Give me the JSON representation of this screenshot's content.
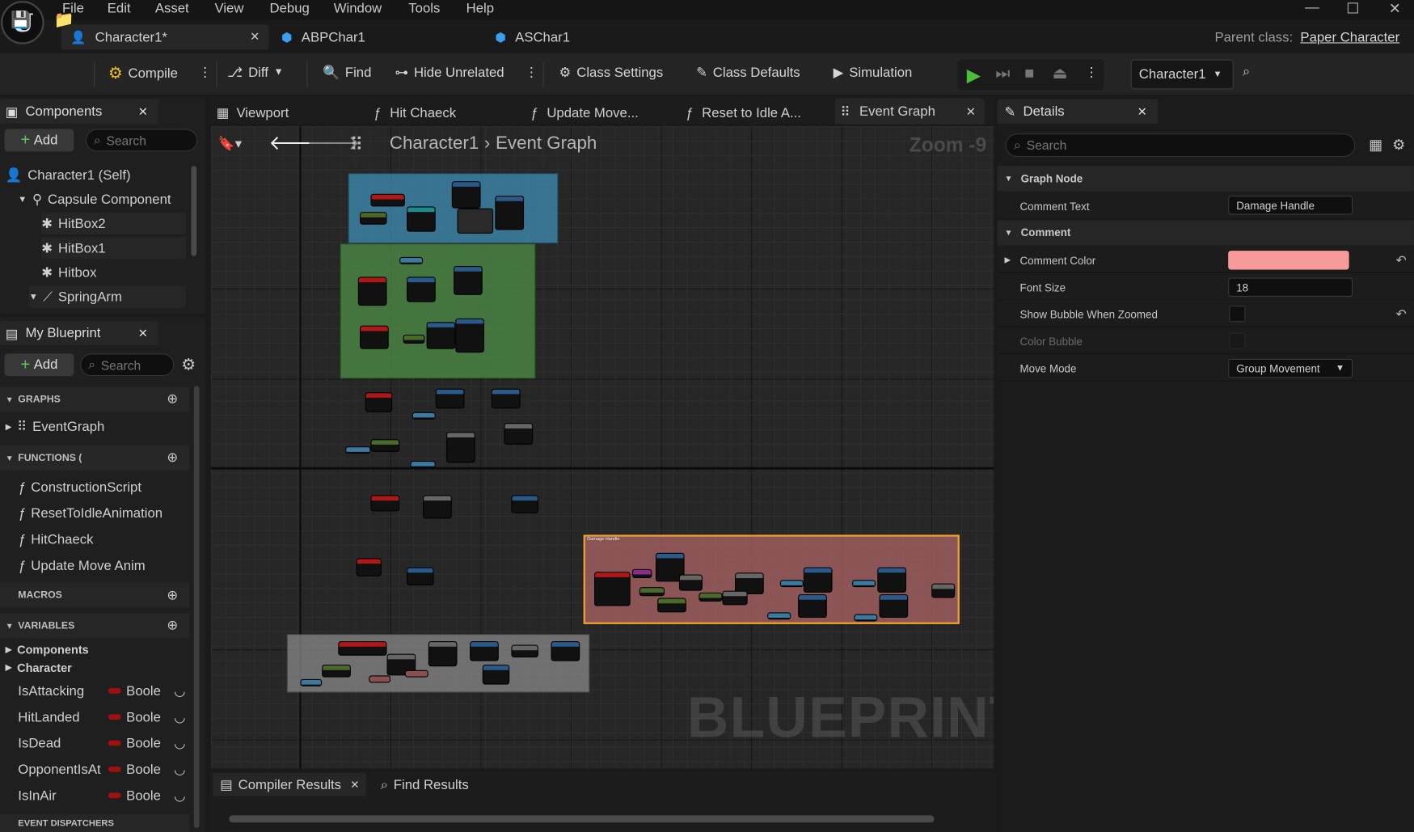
{
  "menu": [
    "File",
    "Edit",
    "Asset",
    "View",
    "Debug",
    "Window",
    "Tools",
    "Help"
  ],
  "doc_tabs": [
    {
      "label": "Character1*",
      "active": true
    },
    {
      "label": "ABPChar1",
      "active": false
    },
    {
      "label": "ASChar1",
      "active": false
    }
  ],
  "parent_class": {
    "label": "Parent class:",
    "value": "Paper Character"
  },
  "toolbar": {
    "compile": "Compile",
    "diff": "Diff",
    "find": "Find",
    "hide_unrelated": "Hide Unrelated",
    "class_settings": "Class Settings",
    "class_defaults": "Class Defaults",
    "simulation": "Simulation",
    "debug_object": "Character1"
  },
  "components": {
    "tab": "Components",
    "add": "Add",
    "search_placeholder": "Search",
    "items": [
      "Character1 (Self)",
      "Capsule Component",
      "HitBox2",
      "HitBox1",
      "Hitbox",
      "SpringArm"
    ]
  },
  "my_blueprint": {
    "tab": "My Blueprint",
    "add": "Add",
    "search_placeholder": "Search",
    "graphs_header": "GRAPHS",
    "graphs": [
      "EventGraph"
    ],
    "functions_header": "FUNCTIONS (",
    "functions": [
      "ConstructionScript",
      "ResetToIdleAnimation",
      "HitChaeck",
      "Update Move Anim"
    ],
    "macros_header": "MACROS",
    "variables_header": "VARIABLES",
    "variable_categories": [
      "Components",
      "Character"
    ],
    "variables": [
      {
        "name": "IsAttacking",
        "type": "Boole"
      },
      {
        "name": "HitLanded",
        "type": "Boole"
      },
      {
        "name": "IsDead",
        "type": "Boole"
      },
      {
        "name": "OpponentIsAt",
        "type": "Boole"
      },
      {
        "name": "IsInAir",
        "type": "Boole"
      }
    ],
    "dispatchers_header": "EVENT DISPATCHERS"
  },
  "graph_tabs": [
    "Viewport",
    "Hit Chaeck",
    "Update Move...",
    "Reset to Idle A...",
    "Event Graph"
  ],
  "breadcrumb": {
    "root": "Character1",
    "current": "Event Graph"
  },
  "zoom": "Zoom -9",
  "watermark": "BLUEPRINT",
  "comments": [
    "Damage Handle"
  ],
  "details": {
    "tab": "Details",
    "search_placeholder": "Search",
    "section_graph_node": "Graph Node",
    "comment_text_label": "Comment Text",
    "comment_text_value": "Damage Handle",
    "section_comment": "Comment",
    "comment_color_label": "Comment Color",
    "comment_color": "#f79a9a",
    "font_size_label": "Font Size",
    "font_size_value": "18",
    "show_bubble_label": "Show Bubble When Zoomed",
    "color_bubble_label": "Color Bubble",
    "move_mode_label": "Move Mode",
    "move_mode_value": "Group Movement"
  },
  "bottom_tabs": [
    "Compiler Results",
    "Find Results"
  ],
  "colors": {
    "accent_blue": "#2a6cd4",
    "play_green": "#4cbf3a",
    "comment_blue": "#3f8fb5",
    "comment_green": "#4e8a46",
    "comment_red": "#b86a6a",
    "comment_gray": "#8a8a8a",
    "selection_orange": "#f0a030"
  }
}
